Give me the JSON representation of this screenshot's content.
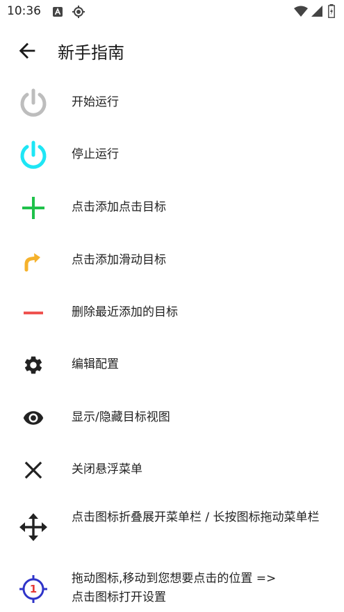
{
  "status_bar": {
    "time": "10:36",
    "icons": [
      "a-notification-icon",
      "gps-icon",
      "wifi-icon",
      "signal-icon",
      "battery-charging-icon"
    ]
  },
  "app_bar": {
    "title": "新手指南",
    "back_icon": "arrow-back-icon"
  },
  "colors": {
    "power_inactive": "#bdbdbd",
    "power_active": "#1ee6f5",
    "add_tap": "#1fc14a",
    "add_swipe": "#f5b22c",
    "remove": "#ef5350",
    "dark_icon": "#222222",
    "target_ring": "#2f34c9",
    "target_number": "#e53935"
  },
  "guide": {
    "items": [
      {
        "icon": "power-off-icon",
        "text": "开始运行"
      },
      {
        "icon": "power-on-icon",
        "text": "停止运行"
      },
      {
        "icon": "plus-icon",
        "text": "点击添加点击目标"
      },
      {
        "icon": "swipe-arrow-icon",
        "text": "点击添加滑动目标"
      },
      {
        "icon": "minus-icon",
        "text": "删除最近添加的目标"
      },
      {
        "icon": "gear-icon",
        "text": "编辑配置"
      },
      {
        "icon": "eye-icon",
        "text": "显示/隐藏目标视图"
      },
      {
        "icon": "close-icon",
        "text": "关闭悬浮菜单"
      },
      {
        "icon": "move-icon",
        "text": "点击图标折叠展开菜单栏 / 长按图标拖动菜单栏"
      },
      {
        "icon": "target-icon",
        "icon_label": "1",
        "text": "拖动图标,移动到您想要点击的位置 =>点击图标打开设置"
      }
    ]
  }
}
